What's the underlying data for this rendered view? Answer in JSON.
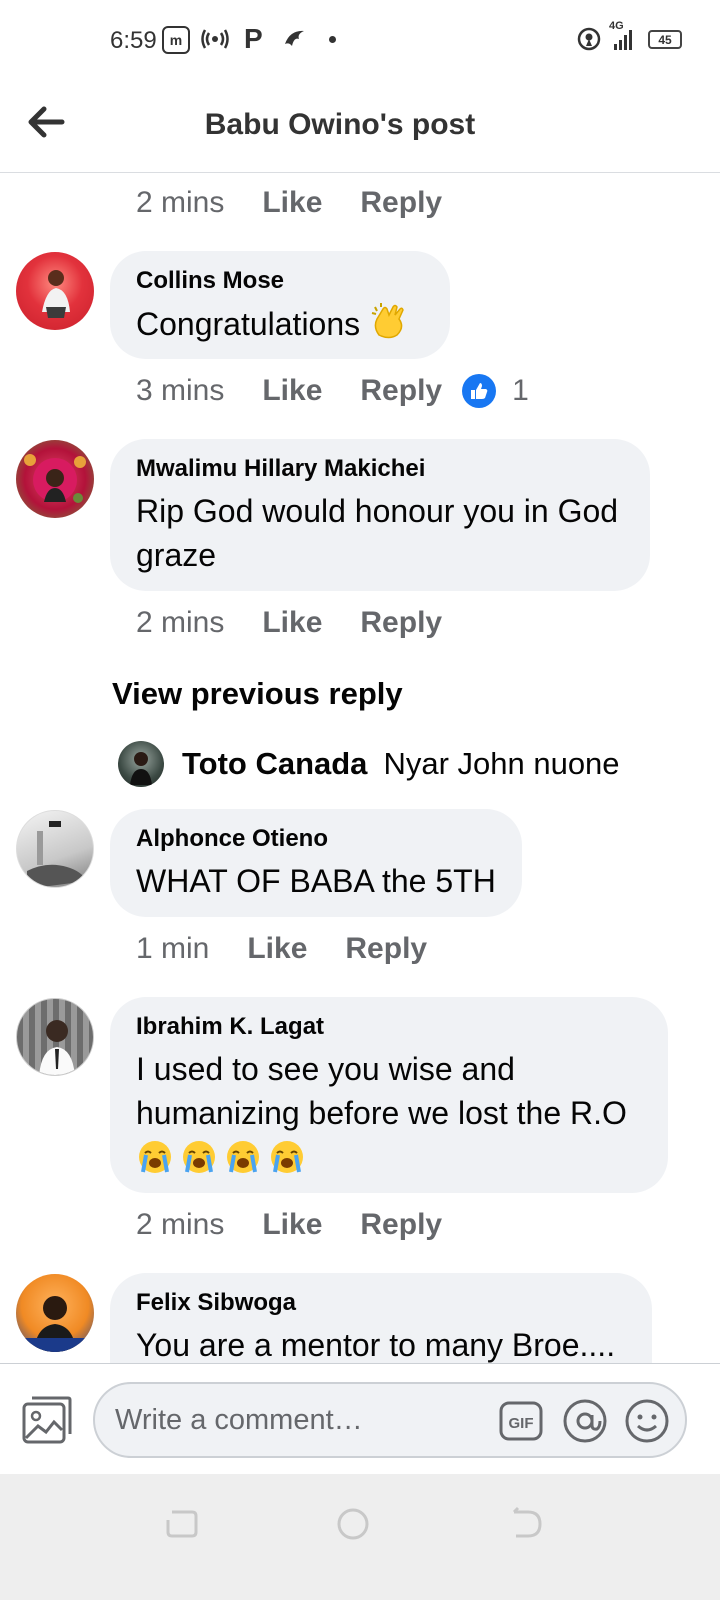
{
  "status_bar": {
    "time": "6:59",
    "network": "4G",
    "battery": "45",
    "icons": [
      "app-badge-icon",
      "wireless-icon",
      "p-icon",
      "bird-icon",
      "dot-icon",
      "hotspot-icon",
      "signal-icon",
      "battery-icon"
    ],
    "p_glyph": "P"
  },
  "header": {
    "title": "Babu Owino's post",
    "back_icon": "arrow-left-icon"
  },
  "comments": [
    {
      "time": "2 mins",
      "like": "Like",
      "reply": "Reply"
    },
    {
      "author": "Collins Mose",
      "text": "Congratulations",
      "emoji": "clapping-hands",
      "time": "3 mins",
      "like": "Like",
      "reply": "Reply",
      "reaction_count": "1",
      "avatar_color": "#e2323c"
    },
    {
      "author": "Mwalimu Hillary Makichei",
      "text": "Rip God would honour you in God graze",
      "time": "2 mins",
      "like": "Like",
      "reply": "Reply",
      "avatar_color": "#b3123a"
    },
    {
      "author": "Alphonce Otieno",
      "text": "WHAT OF BABA the 5TH",
      "time": "1 min",
      "like": "Like",
      "reply": "Reply",
      "avatar_color": "#d9d9d9"
    },
    {
      "author": "Ibrahim K. Lagat",
      "text": "I used to see you wise and humanizing before we lost the R.O",
      "emoji": "loudly-crying-face x4",
      "time": "2 mins",
      "like": "Like",
      "reply": "Reply",
      "avatar_color": "#8a8a8a"
    },
    {
      "author": "Felix Sibwoga",
      "text": "You are a mentor to many Broe....",
      "avatar_color": "#f08a24"
    }
  ],
  "view_previous_reply": "View previous reply",
  "reply_preview": {
    "author": "Toto Canada",
    "text": "Nyar John nuone"
  },
  "composer": {
    "placeholder": "Write a comment…",
    "gif_label": "GIF",
    "icons": [
      "photo-icon",
      "gif-icon",
      "mention-icon",
      "emoji-icon"
    ]
  },
  "nav_bar": {
    "icons": [
      "recents-icon",
      "home-icon",
      "back-icon"
    ]
  },
  "colors": {
    "accent": "#1877f2",
    "bubble": "#f0f2f5",
    "meta_text": "#65676b"
  }
}
